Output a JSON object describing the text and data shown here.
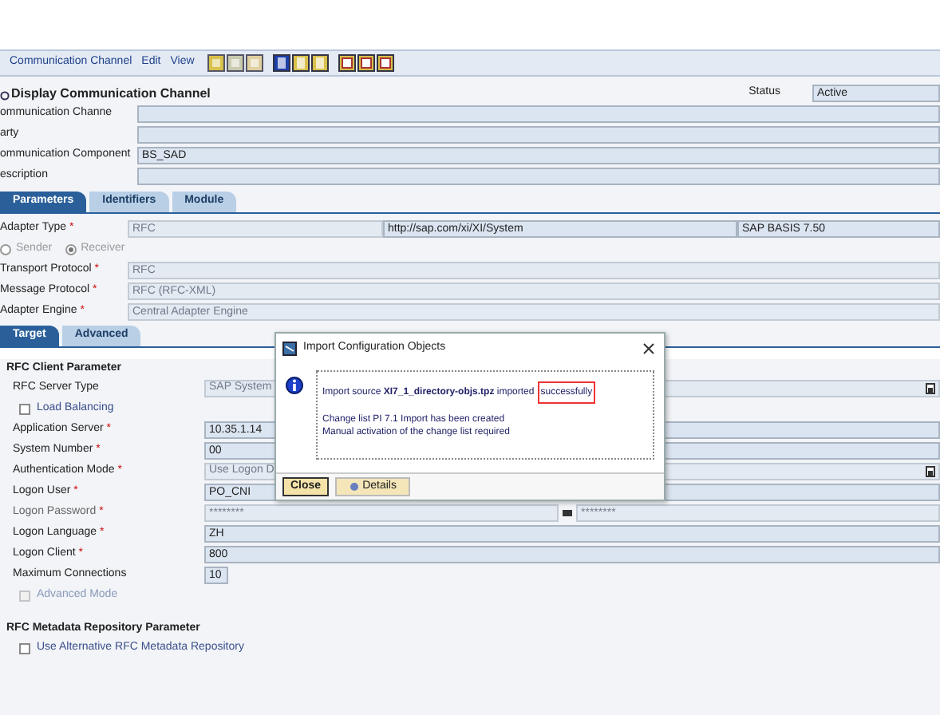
{
  "toolbar": {
    "menus": [
      "Communication Channel",
      "Edit",
      "View"
    ]
  },
  "header": {
    "title": "Display Communication Channel",
    "status_label": "Status",
    "status_value": "Active",
    "fields": [
      {
        "label": "ommunication Channe"
      },
      {
        "label": "arty"
      },
      {
        "label": "ommunication Component",
        "value": "BS_SAD"
      },
      {
        "label": "escription"
      }
    ]
  },
  "tabs": [
    {
      "label": "Parameters",
      "selected": true
    },
    {
      "label": "Identifiers",
      "selected": false
    },
    {
      "label": "Module",
      "selected": false
    }
  ],
  "adapter": {
    "type_label": "Adapter Type",
    "type_mark": "*",
    "type_values": [
      "RFC",
      "http://sap.com/xi/XI/System",
      "SAP BASIS 7.50"
    ],
    "directions": [
      {
        "label": "Sender",
        "selected": false
      },
      {
        "label": "Receiver",
        "selected": true
      }
    ],
    "rows": [
      {
        "label": "Transport Protocol",
        "mark": "*",
        "value": "RFC"
      },
      {
        "label": "Message Protocol",
        "mark": "*",
        "value": "RFC (RFC-XML)"
      },
      {
        "label": "Adapter Engine",
        "mark": "*",
        "value": "Central Adapter Engine"
      }
    ]
  },
  "subtabs": [
    {
      "label": "Target",
      "selected": true
    },
    {
      "label": "Advanced",
      "selected": false
    }
  ],
  "sections": [
    {
      "title": "RFC Client Parameter",
      "rows": [
        {
          "kind": "dropdown",
          "label": "RFC Server Type",
          "value": "SAP System",
          "disabled": true
        },
        {
          "kind": "checkbox",
          "label": "Load Balancing",
          "checked": false,
          "disabled": false
        },
        {
          "kind": "text",
          "label": "Application Server",
          "mark": "*",
          "value": "10.35.1.14",
          "disabled": false
        },
        {
          "kind": "text",
          "label": "System Number",
          "mark": "*",
          "value": "00",
          "disabled": false
        },
        {
          "kind": "dropdown",
          "label": "Authentication Mode",
          "mark": "*",
          "value": "Use Logon D",
          "disabled": true
        },
        {
          "kind": "text",
          "label": "Logon User",
          "mark": "*",
          "value": "PO_CNI",
          "disabled": false
        },
        {
          "kind": "password",
          "label": "Logon Password",
          "mark": "*",
          "value": "********",
          "confirm": "********",
          "disabled": true
        },
        {
          "kind": "text",
          "label": "Logon Language",
          "mark": "*",
          "value": "ZH",
          "disabled": false
        },
        {
          "kind": "text",
          "label": "Logon Client",
          "mark": "*",
          "value": "800",
          "disabled": false
        },
        {
          "kind": "short",
          "label": "Maximum Connections",
          "value": "10",
          "disabled": false
        },
        {
          "kind": "checkbox",
          "label": "Advanced Mode",
          "checked": false,
          "disabled": true
        }
      ]
    },
    {
      "title": "RFC Metadata Repository Parameter",
      "rows": [
        {
          "kind": "checkbox",
          "label": "Use Alternative RFC Metadata Repository",
          "checked": false,
          "disabled": false
        }
      ]
    }
  ],
  "dialog": {
    "title": "Import Configuration Objects",
    "message": "Import source **XI7_1_directory-objs.tpz** imported",
    "highlight": "successfully",
    "lines": [
      "Change list PI 7.1 Import has been created",
      "Manual activation of the change list required"
    ],
    "buttons": [
      {
        "label": "Close",
        "kind": "primary"
      },
      {
        "label": "Details",
        "kind": "details"
      }
    ]
  }
}
